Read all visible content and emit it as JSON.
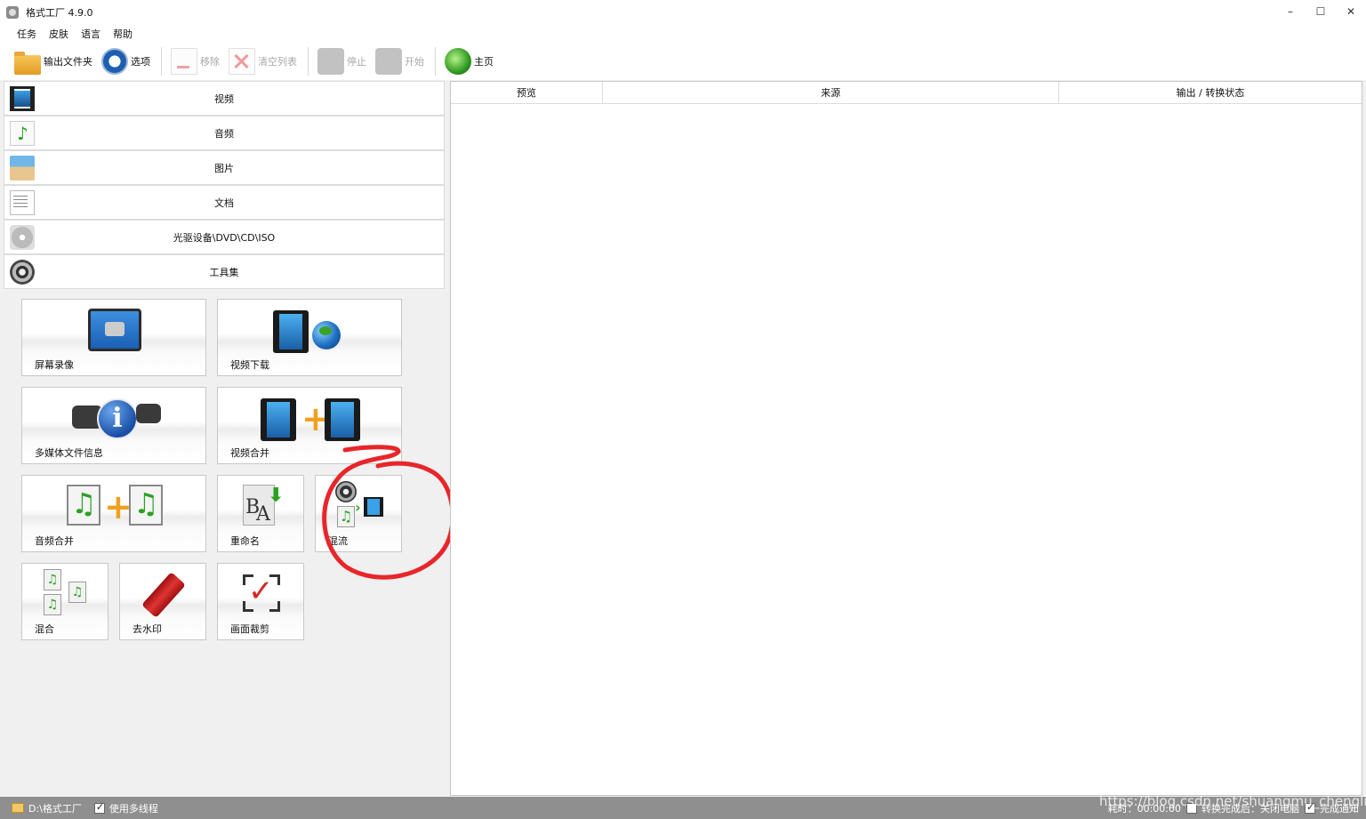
{
  "window": {
    "title": "格式工厂 4.9.0",
    "controls": {
      "minimize": "–",
      "maximize": "☐",
      "close": "✕"
    }
  },
  "menu": [
    "任务",
    "皮肤",
    "语言",
    "帮助"
  ],
  "toolbar": {
    "output_folder": "输出文件夹",
    "options": "选项",
    "remove": "移除",
    "clear_list": "清空列表",
    "stop": "停止",
    "start": "开始",
    "home": "主页"
  },
  "categories": [
    {
      "label": "视频",
      "icon": "video-icon"
    },
    {
      "label": "音频",
      "icon": "audio-icon"
    },
    {
      "label": "图片",
      "icon": "image-icon"
    },
    {
      "label": "文档",
      "icon": "document-icon"
    },
    {
      "label": "光驱设备\\DVD\\CD\\ISO",
      "icon": "disc-icon"
    },
    {
      "label": "工具集",
      "icon": "tools-icon"
    }
  ],
  "tools": {
    "screen_record": "屏幕录像",
    "video_download": "视频下载",
    "media_info": "多媒体文件信息",
    "video_join": "视频合并",
    "audio_join": "音频合并",
    "rename": "重命名",
    "mux": "混流",
    "mix": "混合",
    "remove_watermark": "去水印",
    "crop": "画面裁剪"
  },
  "grid": {
    "columns": [
      "预览",
      "来源",
      "输出 / 转换状态"
    ]
  },
  "status": {
    "output_path": "D:\\格式工厂",
    "multithread_label": "使用多线程",
    "multithread_checked": true,
    "elapsed": "耗时：00:00:00",
    "after_done_label": "转换完成后：关闭电脑",
    "after_done_checked": false,
    "notify_label": "完成通知",
    "notify_checked": true
  },
  "watermark": "https://blog.csdn.net/shuangmu_chenglin",
  "colors": {
    "highlight_circle": "#e8262a",
    "statusbar": "#8f8f8f",
    "accent_green": "#2aa121"
  }
}
